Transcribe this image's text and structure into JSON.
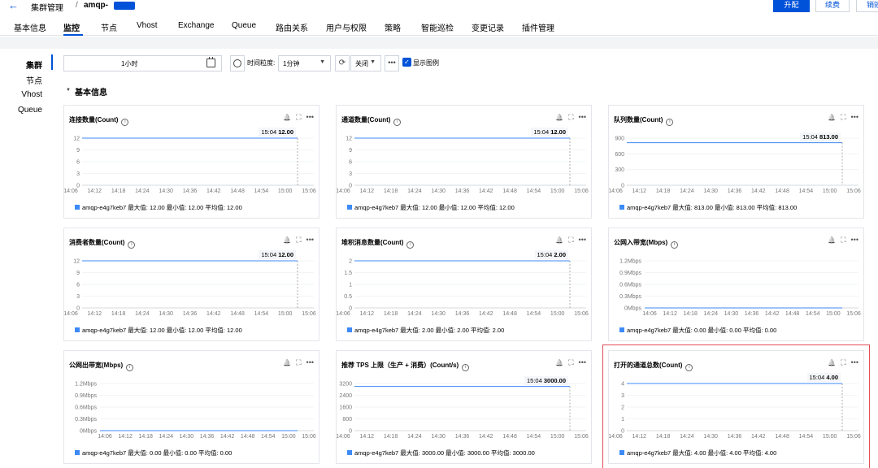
{
  "header": {
    "back_icon": "arrow-left-icon",
    "breadcrumb_root": "集群管理",
    "breadcrumb_sep": "/",
    "breadcrumb_current": "amqp-",
    "btn_upgrade": "升配",
    "btn_renew": "续费",
    "btn_destroy": "销毁"
  },
  "tabs": [
    "基本信息",
    "监控",
    "节点",
    "Vhost",
    "Exchange",
    "Queue",
    "路由关系",
    "用户与权限",
    "策略",
    "智能巡检",
    "变更记录",
    "插件管理"
  ],
  "sidenav": [
    "集群",
    "节点",
    "Vhost",
    "Queue"
  ],
  "controls": {
    "time_range": "1小时",
    "granularity_label": "时间粒度:",
    "granularity": "1分钟",
    "refresh": "关闭",
    "show_legend": "显示图例"
  },
  "section_title": "基本信息",
  "x_ticks": [
    "14:06",
    "14:12",
    "14:18",
    "14:24",
    "14:30",
    "14:36",
    "14:42",
    "14:48",
    "14:54",
    "15:00",
    "15:06"
  ],
  "cards": [
    {
      "title": "连接数量(Count)",
      "tooltip_time": "15:04",
      "tooltip_value": "12.00",
      "y_ticks": [
        "12",
        "9",
        "6",
        "3",
        "0"
      ],
      "level": 1.0,
      "legend": "amqp-e4g7keb7  最大值: 12.00  最小值: 12.00  平均值: 12.00"
    },
    {
      "title": "通道数量(Count)",
      "tooltip_time": "15:04",
      "tooltip_value": "12.00",
      "y_ticks": [
        "12",
        "9",
        "6",
        "3",
        "0"
      ],
      "level": 1.0,
      "legend": "amqp-e4g7keb7  最大值: 12.00  最小值: 12.00  平均值: 12.00"
    },
    {
      "title": "队列数量(Count)",
      "tooltip_time": "15:04",
      "tooltip_value": "813.00",
      "y_ticks": [
        "900",
        "600",
        "300",
        "0"
      ],
      "level": 0.9033,
      "legend": "amqp-e4g7keb7  最大值: 813.00  最小值: 813.00  平均值: 813.00"
    },
    {
      "title": "消费者数量(Count)",
      "tooltip_time": "15:04",
      "tooltip_value": "12.00",
      "y_ticks": [
        "12",
        "9",
        "6",
        "3",
        "0"
      ],
      "level": 1.0,
      "legend": "amqp-e4g7keb7  最大值: 12.00  最小值: 12.00  平均值: 12.00"
    },
    {
      "title": "堆积消息数量(Count)",
      "tooltip_time": "15:04",
      "tooltip_value": "2.00",
      "y_ticks": [
        "2",
        "1.5",
        "1",
        "0.5",
        "0"
      ],
      "level": 1.0,
      "legend": "amqp-e4g7keb7  最大值: 2.00  最小值: 2.00  平均值: 2.00"
    },
    {
      "title": "公网入带宽(Mbps)",
      "tooltip_time": "",
      "tooltip_value": "",
      "y_ticks": [
        "1.2Mbps",
        "0.9Mbps",
        "0.6Mbps",
        "0.3Mbps",
        "0Mbps"
      ],
      "level": 0.0,
      "legend": "amqp-e4g7keb7  最大值: 0.00  最小值: 0.00  平均值: 0.00"
    },
    {
      "title": "公网出带宽(Mbps)",
      "tooltip_time": "",
      "tooltip_value": "",
      "y_ticks": [
        "1.2Mbps",
        "0.9Mbps",
        "0.6Mbps",
        "0.3Mbps",
        "0Mbps"
      ],
      "level": 0.0,
      "legend": "amqp-e4g7keb7  最大值: 0.00  最小值: 0.00  平均值: 0.00"
    },
    {
      "title": "推荐 TPS 上限（生产 + 消费）(Count/s)",
      "tooltip_time": "15:04",
      "tooltip_value": "3000.00",
      "y_ticks": [
        "3200",
        "2400",
        "1600",
        "800",
        "0"
      ],
      "level": 0.9375,
      "legend": "amqp-e4g7keb7  最大值: 3000.00  最小值: 3000.00  平均值: 3000.00"
    },
    {
      "title": "打开的通道总数(Count)",
      "tooltip_time": "15:04",
      "tooltip_value": "4.00",
      "y_ticks": [
        "4",
        "3",
        "2",
        "1",
        "0"
      ],
      "level": 1.0,
      "legend": "amqp-e4g7keb7  最大值: 4.00  最小值: 4.00  平均值: 4.00",
      "highlighted": true
    }
  ],
  "colors": {
    "accent": "#0052d9",
    "series": "#3d8af7",
    "highlight": "#e34d59"
  }
}
